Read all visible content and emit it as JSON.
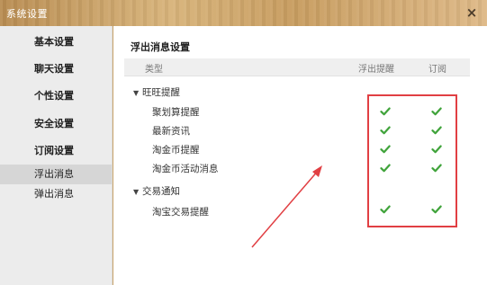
{
  "window": {
    "title": "系统设置",
    "close_glyph": "×"
  },
  "sidebar": {
    "items": [
      {
        "label": "基本设置"
      },
      {
        "label": "聊天设置"
      },
      {
        "label": "个性设置"
      },
      {
        "label": "安全设置"
      },
      {
        "label": "订阅设置"
      },
      {
        "label": "浮出消息"
      },
      {
        "label": "弹出消息"
      }
    ]
  },
  "main": {
    "section_title": "浮出消息设置",
    "columns": {
      "type": "类型",
      "float": "浮出提醒",
      "subscribe": "订阅"
    },
    "groups": [
      {
        "label": "旺旺提醒",
        "items": [
          {
            "label": "聚划算提醒",
            "float": true,
            "subscribe": true
          },
          {
            "label": "最新资讯",
            "float": true,
            "subscribe": true
          },
          {
            "label": "淘金币提醒",
            "float": true,
            "subscribe": true
          },
          {
            "label": "淘金币活动消息",
            "float": true,
            "subscribe": true
          }
        ]
      },
      {
        "label": "交易通知",
        "items": [
          {
            "label": "淘宝交易提醒",
            "float": true,
            "subscribe": true
          }
        ]
      }
    ]
  },
  "colors": {
    "check_green": "#3fa33a",
    "annotation_red": "#e13f43",
    "title_bar_wood": "#c89d60"
  },
  "icons": {
    "check": "checkmark-icon",
    "caret": "caret-down-icon",
    "close": "close-icon"
  }
}
